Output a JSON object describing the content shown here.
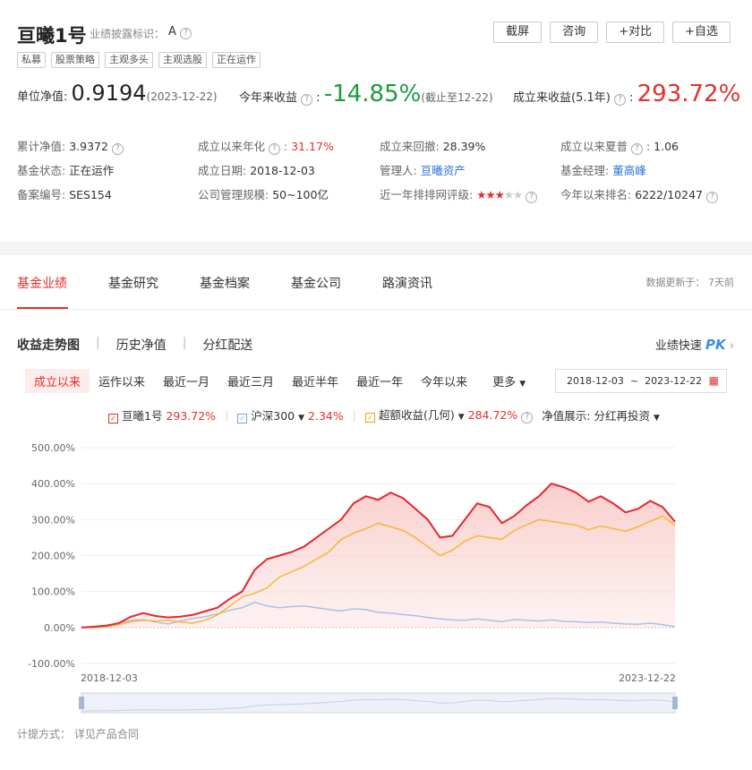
{
  "fund": {
    "name": "亘曦1号",
    "disclose_label": "业绩披露标识：",
    "disclose_value": "A",
    "tags": [
      "私募",
      "股票策略",
      "主观多头",
      "主观选股",
      "正在运作"
    ],
    "buttons": [
      "截屏",
      "咨询",
      "+对比",
      "+自选"
    ]
  },
  "summary": {
    "nav_label": "单位净值:",
    "nav_value": "0.9194",
    "nav_date": "(2023-12-22)",
    "ytd_label": "今年来收益",
    "ytd_value": "-14.85%",
    "ytd_note": "(截止至12-22)",
    "since_label": "成立来收益(5.1年)",
    "since_value": "293.72%"
  },
  "info": [
    [
      {
        "label": "累计净值:",
        "value": "3.9372",
        "help": true
      },
      {
        "label": "成立以来年化",
        "value": "31.17%",
        "help": true,
        "red": true
      },
      {
        "label": "成立来回撤:",
        "value": "28.39%"
      },
      {
        "label": "成立以来夏普",
        "value": "1.06",
        "help": true
      }
    ],
    [
      {
        "label": "基金状态:",
        "value": "正在运作"
      },
      {
        "label": "成立日期:",
        "value": "2018-12-03"
      },
      {
        "label": "管理人:",
        "value": "亘曦资产",
        "link": true
      },
      {
        "label": "基金经理:",
        "value": "董高峰",
        "link": true
      }
    ],
    [
      {
        "label": "备案编号:",
        "value": "SES154"
      },
      {
        "label": "公司管理规模:",
        "value": "50~100亿"
      },
      {
        "label": "近一年排排网评级:",
        "stars": 3,
        "help": true
      },
      {
        "label": "今年以来排名:",
        "value": "6222/10247",
        "help": true
      }
    ]
  ],
  "tabs": [
    "基金业绩",
    "基金研究",
    "基金档案",
    "基金公司",
    "路演资讯"
  ],
  "update_text": "数据更新于： 7天前",
  "subtabs": [
    "收益走势图",
    "历史净值",
    "分红配送"
  ],
  "pk_label": "业绩快速",
  "pk_mark": "PK",
  "ranges": [
    "成立以来",
    "运作以来",
    "最近一月",
    "最近三月",
    "最近半年",
    "最近一年",
    "今年以来",
    "更多"
  ],
  "date_from": "2018-12-03",
  "date_to": "2023-12-22",
  "legend": {
    "fund": "亘曦1号",
    "fund_value": "293.72%",
    "index": "沪深300",
    "index_value": "2.34%",
    "excess": "超额收益(几何)",
    "excess_value": "284.72%",
    "nav_display_label": "净值展示:",
    "nav_display_value": "分红再投资"
  },
  "footer": "计提方式： 详见产品合同",
  "colors": {
    "fund": "#e8262c",
    "index": "#aac0e8",
    "excess": "#f7b733"
  },
  "chart_data": {
    "type": "line",
    "x_start": "2018-12-03",
    "x_end": "2023-12-22",
    "y_ticks": [
      "500.00%",
      "400.00%",
      "300.00%",
      "200.00%",
      "100.00%",
      "0.00%",
      "-100.00%"
    ],
    "ylim": [
      -100,
      500
    ],
    "x_ticks": [
      "2018-12-03",
      "2023-12-22"
    ],
    "series": [
      {
        "name": "亘曦1号",
        "values": [
          0,
          2,
          5,
          12,
          30,
          40,
          32,
          28,
          30,
          35,
          45,
          55,
          80,
          100,
          160,
          190,
          200,
          210,
          225,
          250,
          275,
          300,
          345,
          365,
          355,
          375,
          360,
          330,
          300,
          250,
          255,
          300,
          345,
          335,
          290,
          310,
          340,
          365,
          400,
          390,
          375,
          350,
          365,
          345,
          320,
          330,
          352,
          335,
          294
        ]
      },
      {
        "name": "沪深300",
        "values": [
          0,
          3,
          6,
          12,
          20,
          22,
          15,
          10,
          18,
          25,
          30,
          38,
          48,
          55,
          70,
          60,
          55,
          58,
          60,
          55,
          50,
          46,
          52,
          50,
          42,
          40,
          36,
          33,
          28,
          24,
          21,
          20,
          24,
          20,
          16,
          22,
          20,
          18,
          21,
          17,
          16,
          14,
          15,
          12,
          10,
          9,
          12,
          8,
          2
        ]
      },
      {
        "name": "超额收益(几何)",
        "values": [
          0,
          0,
          2,
          8,
          16,
          20,
          18,
          20,
          15,
          12,
          20,
          35,
          60,
          85,
          95,
          110,
          140,
          155,
          170,
          190,
          210,
          245,
          262,
          275,
          290,
          280,
          270,
          250,
          225,
          200,
          215,
          240,
          255,
          250,
          245,
          270,
          285,
          300,
          295,
          290,
          285,
          272,
          282,
          275,
          268,
          280,
          295,
          310,
          285
        ]
      }
    ]
  }
}
